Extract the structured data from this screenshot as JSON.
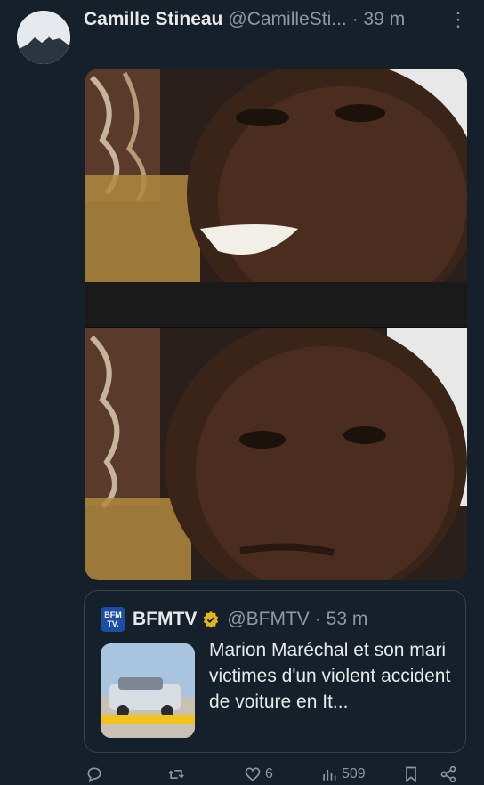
{
  "tweet": {
    "display_name": "Camille Stineau",
    "handle": "@CamilleSti...",
    "time": "· 39 m",
    "more_icon": "more-vertical-icon"
  },
  "quote": {
    "logo_text_top": "BFM",
    "logo_text_bottom": "TV.",
    "name": "BFMTV",
    "handle": "@BFMTV",
    "time": "· 53 m",
    "text": "Marion Maréchal et son mari victimes d'un violent accident de voiture en It...",
    "verified_color": "#e2b719",
    "logo_color": "#1d4ea6"
  },
  "actions": {
    "reply": "",
    "retweet": "",
    "like": "6",
    "views": "509"
  },
  "colors": {
    "background": "#15202b",
    "text": "#e7e9ea",
    "muted": "#8b98a5",
    "border": "#38444d"
  }
}
